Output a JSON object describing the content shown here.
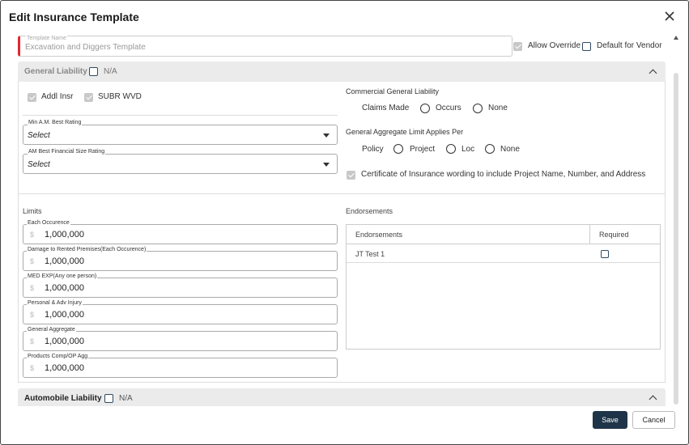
{
  "dialog": {
    "title": "Edit Insurance Template"
  },
  "template": {
    "name_label": "Template Name",
    "name_value": "Excavation and Diggers Template",
    "allow_override_label": "Allow Override",
    "default_vendor_label": "Default for Vendor"
  },
  "general_liability": {
    "title": "General Liability",
    "na_label": "N/A",
    "addl_insr_label": "Addl Insr",
    "subr_wvd_label": "SUBR WVD",
    "min_am_best": {
      "label": "Min A.M. Best Rating",
      "value": "Select"
    },
    "am_best_size": {
      "label": "AM Best Financial Size Rating",
      "value": "Select"
    },
    "cgl": {
      "title": "Commercial General Liability",
      "options": [
        "Claims Made",
        "Occurs",
        "None"
      ]
    },
    "aggregate": {
      "title": "General Aggregate Limit Applies Per",
      "options": [
        "Policy",
        "Project",
        "Loc",
        "None"
      ]
    },
    "certificate_label": "Certificate of Insurance wording to include Project Name, Number, and Address",
    "limits_title": "Limits",
    "limits": [
      {
        "label": "Each Occurence",
        "currency": "$",
        "value": "1,000,000"
      },
      {
        "label": "Damage to Rented Premises(Each Occurence)",
        "currency": "$",
        "value": "1,000,000"
      },
      {
        "label": "MED EXP(Any one person)",
        "currency": "$",
        "value": "1,000,000"
      },
      {
        "label": "Personal & Adv Injury",
        "currency": "$",
        "value": "1,000,000"
      },
      {
        "label": "General Aggregate",
        "currency": "$",
        "value": "1,000,000"
      },
      {
        "label": "Products Comp/OP Agg",
        "currency": "$",
        "value": "1,000,000"
      }
    ],
    "endorsements": {
      "title": "Endorsements",
      "headers": [
        "Endorsements",
        "Required"
      ],
      "rows": [
        {
          "name": "JT Test 1",
          "required": false
        }
      ]
    }
  },
  "automobile_liability": {
    "title": "Automobile Liability",
    "na_label": "N/A"
  },
  "buttons": {
    "save": "Save",
    "cancel": "Cancel"
  },
  "colors": {
    "primary": "#1e3448",
    "required_marker": "#e0282e",
    "section_bg": "#ebebeb"
  }
}
